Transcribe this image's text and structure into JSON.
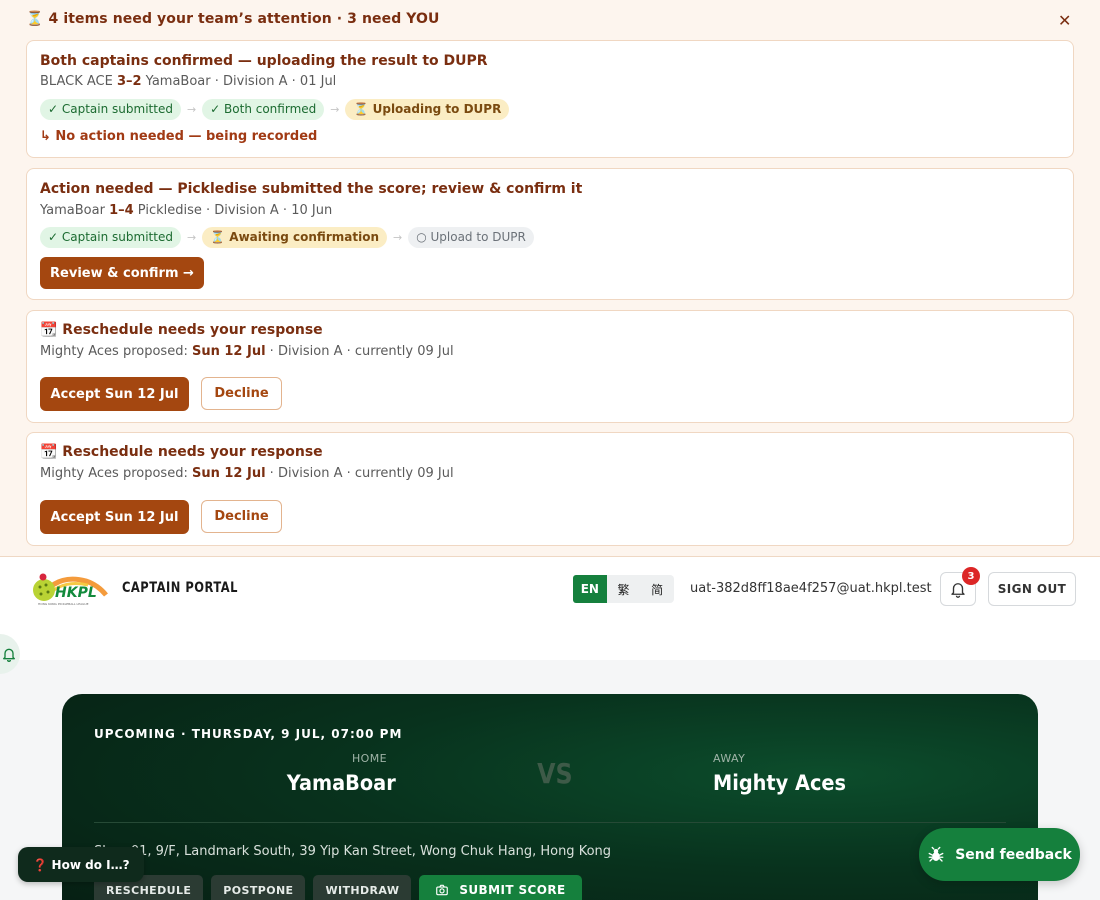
{
  "banner": {
    "heading": "⏳ 4 items need your team’s attention · 3 need YOU",
    "close_glyph": "✕"
  },
  "cards": [
    {
      "title": "Both captains confirmed — uploading the result to DUPR",
      "sub_pre": "BLACK ACE ",
      "sub_bold": "3–2",
      "sub_post": " YamaBoar · Division A · 01 Jul",
      "chips": [
        "✓ Captain submitted",
        "✓ Both confirmed",
        "⏳ Uploading to DUPR"
      ],
      "arrow": "→",
      "note": "↳ No action needed — being recorded"
    },
    {
      "title": "Action needed — Pickledise submitted the score; review & confirm it",
      "sub_pre": "YamaBoar ",
      "sub_bold": "1–4",
      "sub_post": " Pickledise · Division A · 10 Jun",
      "chips": [
        "✓ Captain submitted",
        "⏳ Awaiting confirmation",
        "○ Upload to DUPR"
      ],
      "arrow": "→",
      "button": "Review & confirm →"
    },
    {
      "title": "📆 Reschedule needs your response",
      "sub_pre": "Mighty Aces proposed: ",
      "sub_bold": "Sun 12 Jul",
      "sub_post": " · Division A · currently 09 Jul",
      "accept": "Accept Sun 12 Jul",
      "decline": "Decline"
    },
    {
      "title": "📆 Reschedule needs your response",
      "sub_pre": "Mighty Aces proposed: ",
      "sub_bold": "Sun 12 Jul",
      "sub_post": " · Division A · currently 09 Jul",
      "accept": "Accept Sun 12 Jul",
      "decline": "Decline"
    }
  ],
  "header": {
    "logo_text": "HKPL",
    "logo_tagline": "HONG KONG PICKLEBALL LEAGUE",
    "portal_name": "CAPTAIN PORTAL",
    "languages": [
      "EN",
      "繁",
      "简"
    ],
    "active_language": "EN",
    "user_email": "uat-382d8ff18ae4f257@uat.hkpl.test",
    "notification_count": "3",
    "sign_out": "SIGN OUT"
  },
  "match": {
    "date_line": "UPCOMING · THURSDAY, 9 JUL, 07:00 PM",
    "home_label": "HOME",
    "home_team": "YamaBoar",
    "vs": "VS",
    "away_label": "AWAY",
    "away_team": "Mighty Aces",
    "venue": "Shop 01, 9/F, Landmark South, 39 Yip Kan Street, Wong Chuk Hang, Hong Kong",
    "actions": [
      "RESCHEDULE",
      "POSTPONE",
      "WITHDRAW"
    ],
    "submit_label": "SUBMIT SCORE"
  },
  "floating": {
    "help": "❓ How do I…?",
    "feedback": "Send feedback"
  },
  "colors": {
    "accent_brown": "#a44710",
    "banner_text": "#7a2e10",
    "brand_green": "#15803d",
    "badge_red": "#dc2626"
  }
}
